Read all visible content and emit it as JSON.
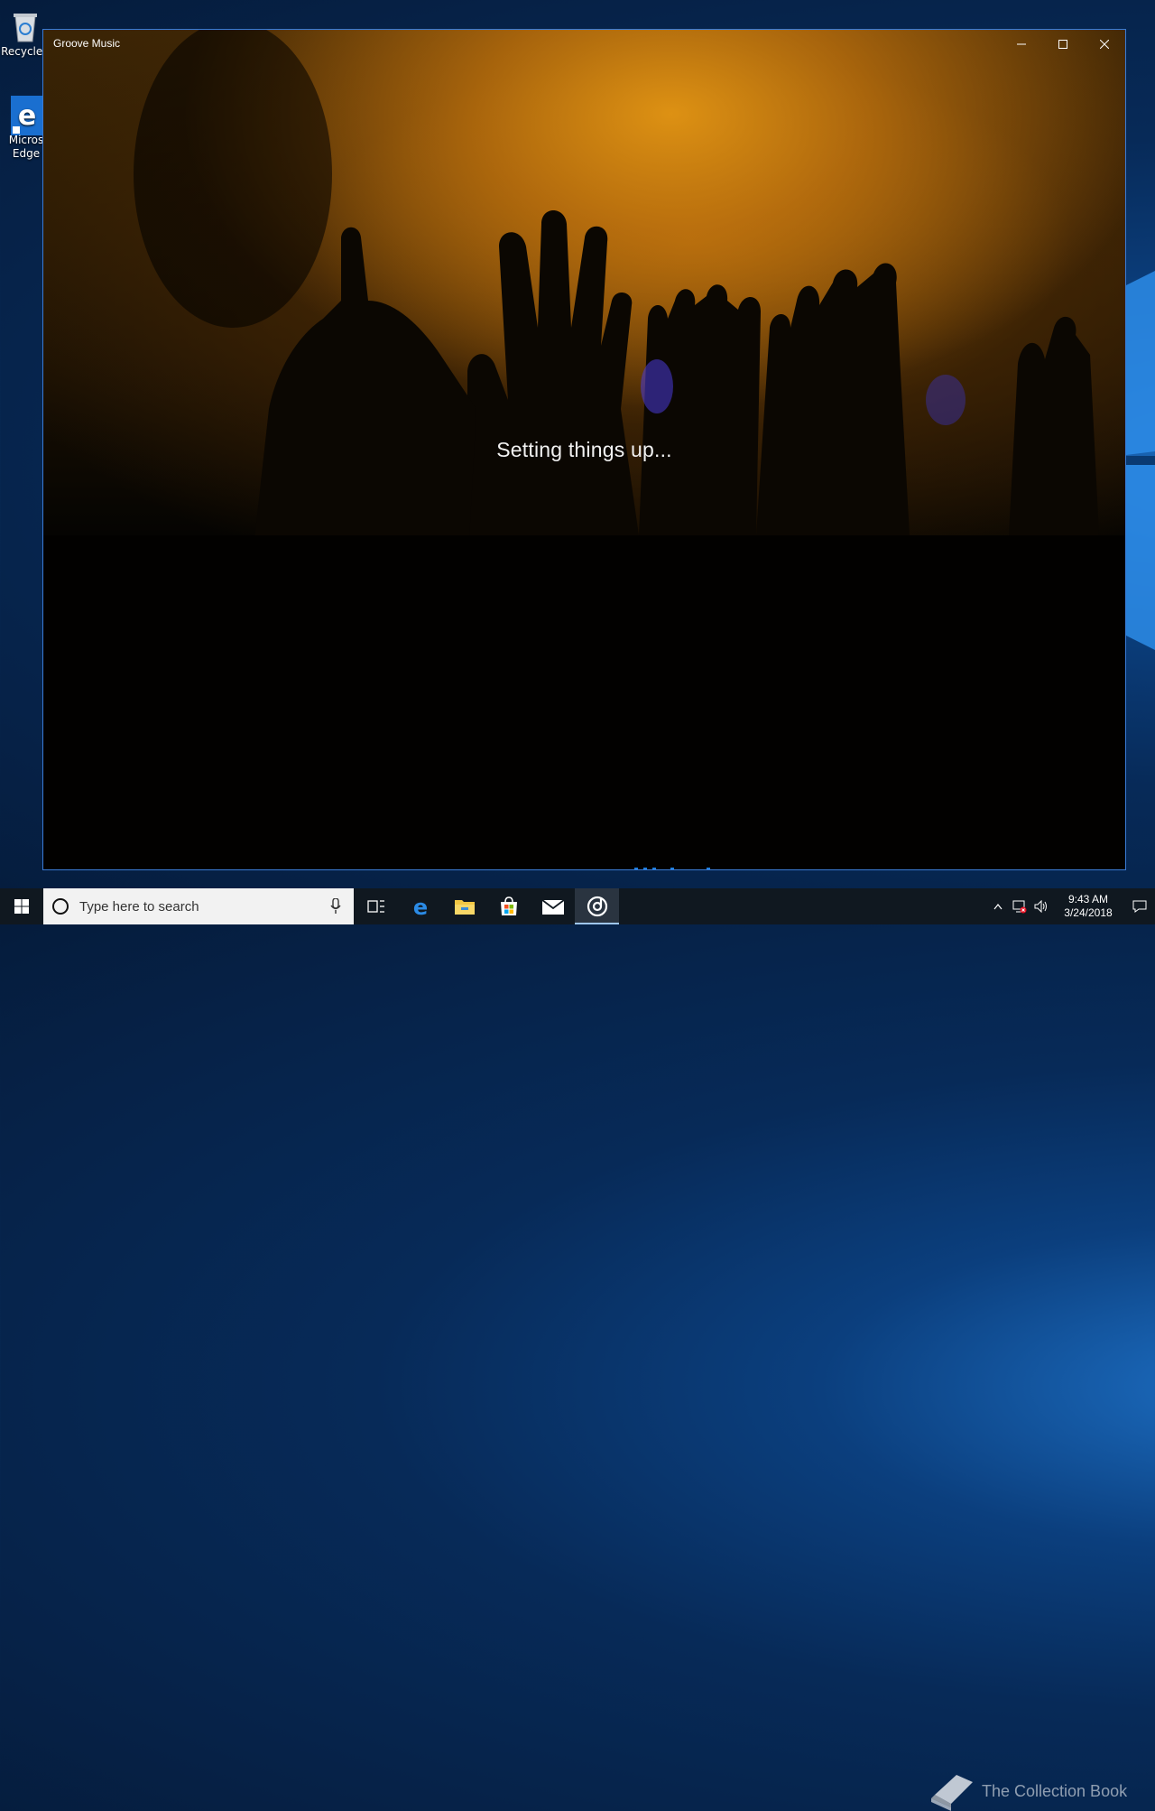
{
  "desktop": {
    "icons": [
      {
        "label": "Recycle  "
      },
      {
        "label": "Micros\nEdge"
      }
    ]
  },
  "window": {
    "title": "Groove Music",
    "status_text": "Setting things up...",
    "accent_color": "#3a7bd5"
  },
  "taskbar": {
    "search_placeholder": "Type here to search",
    "pinned": [
      "task-view-icon",
      "edge-icon",
      "file-explorer-icon",
      "store-icon",
      "mail-icon",
      "groove-music-icon"
    ],
    "active_app": "Groove Music",
    "clock": {
      "time": "9:43 AM",
      "date": "3/24/2018"
    }
  },
  "watermark": {
    "text": "The Collection Book"
  }
}
